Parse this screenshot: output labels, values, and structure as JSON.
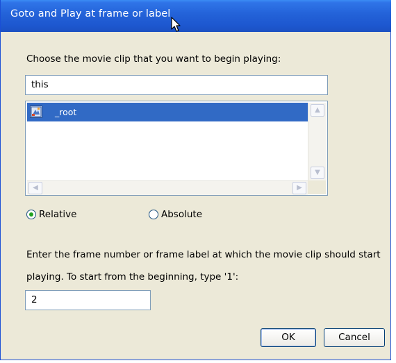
{
  "dialog": {
    "title": "Goto and Play at frame or label"
  },
  "clip_section": {
    "prompt": "Choose the movie clip that you want to begin playing:",
    "target_value": "this",
    "list_items": [
      {
        "label": "_root",
        "selected": true,
        "icon": "movie-clip-icon"
      }
    ]
  },
  "path_mode": {
    "options": [
      "Relative",
      "Absolute"
    ],
    "selected": "Relative"
  },
  "frame_section": {
    "instruction_line1": "Enter the frame number or frame label at which the movie clip should start",
    "instruction_line2": "playing.  To start from the beginning, type '1':",
    "frame_value": "2"
  },
  "buttons": {
    "ok_label": "OK",
    "cancel_label": "Cancel"
  },
  "colors": {
    "titlebar": "#2362d8",
    "selection": "#316ac5",
    "radio_dot": "#21a121",
    "dialog_bg": "#ece9d8"
  }
}
